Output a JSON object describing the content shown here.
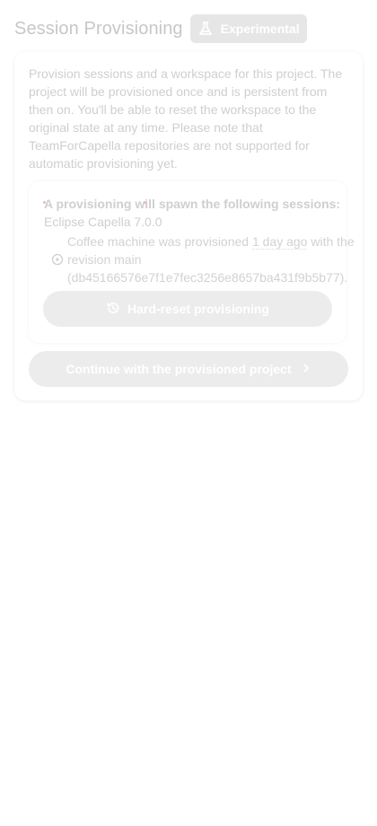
{
  "header": {
    "title": "Session Provisioning",
    "badge_label": "Experimental",
    "badge_icon": "flask-icon"
  },
  "card": {
    "description": "Provision sessions and a workspace for this project. The project will be provisioned once and is persistent from then on. You'll be able to reset the workspace to the original state at any time. Please note that TeamForCapella repositories are not supported for automatic provisioning yet.",
    "provisioning": {
      "title": "A provisioning will spawn the following sessions:",
      "tool": "Eclipse Capella 7.0.0",
      "session_prefix": "Coffee machine was provisioned",
      "session_time": "1 day ago",
      "session_mid": "with the revision main",
      "session_hash": "(db45166576e7f1e7fec3256e8657ba431f9b5b77).",
      "session_icon": "play-circle-icon",
      "reset_label": "Hard-reset provisioning",
      "reset_icon": "history-icon"
    },
    "continue_label": "Continue with the provisioned project",
    "continue_icon": "chevron-right-icon"
  },
  "colors": {
    "muted_text": "#cfcfcf",
    "button_bg": "#ececec",
    "badge_bg": "#e6e6e6"
  }
}
